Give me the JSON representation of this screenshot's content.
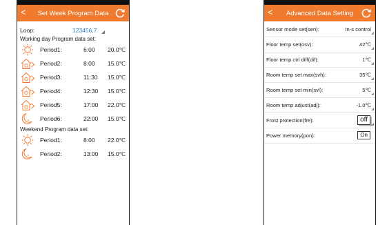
{
  "left": {
    "title": "Set Week Program Data",
    "back_glyph": "<",
    "loop_label": "Loop:",
    "loop_value": "123456,7",
    "working_header": "Working day Program data set:",
    "weekend_header": "Weekend  Program data set:",
    "working_periods": [
      {
        "label": "Period1:",
        "time": "6:00",
        "temp": "20.0℃",
        "icon": "sun-icon"
      },
      {
        "label": "Period2:",
        "time": "8:00",
        "temp": "15.0℃",
        "icon": "house-away-icon"
      },
      {
        "label": "Period3:",
        "time": "11:30",
        "temp": "15.0℃",
        "icon": "house-sun-icon"
      },
      {
        "label": "Period4:",
        "time": "12:30",
        "temp": "15.0℃",
        "icon": "house-sun-icon"
      },
      {
        "label": "Period5:",
        "time": "17:00",
        "temp": "22.0℃",
        "icon": "house-away-icon"
      },
      {
        "label": "Period6:",
        "time": "22:00",
        "temp": "15.0℃",
        "icon": "moon-icon"
      }
    ],
    "weekend_periods": [
      {
        "label": "Period1:",
        "time": "8:00",
        "temp": "22.0℃",
        "icon": "sun-icon"
      },
      {
        "label": "Period2:",
        "time": "13:00",
        "temp": "15.0℃",
        "icon": "moon-icon"
      }
    ]
  },
  "right": {
    "title": "Advanced Data Setting",
    "back_glyph": "<",
    "settings": [
      {
        "label": "Sensor mode set(sen):",
        "value": "In-s control"
      },
      {
        "label": "Floor temp set(osv):",
        "value": "42℃"
      },
      {
        "label": "Floor temp ctrl diff(dif):",
        "value": "1℃"
      },
      {
        "label": "Room temp set max(svh):",
        "value": "35℃"
      },
      {
        "label": "Room temp set min(svl):",
        "value": "5℃"
      },
      {
        "label": "Room temp adjust(adj):",
        "value": "-1.0℃"
      },
      {
        "label": "Frost protection(fre):",
        "value": "off"
      },
      {
        "label": "Power memory(pon):",
        "value": "On"
      }
    ]
  },
  "colors": {
    "accent": "#f07a2e",
    "link": "#2a7fd0"
  }
}
